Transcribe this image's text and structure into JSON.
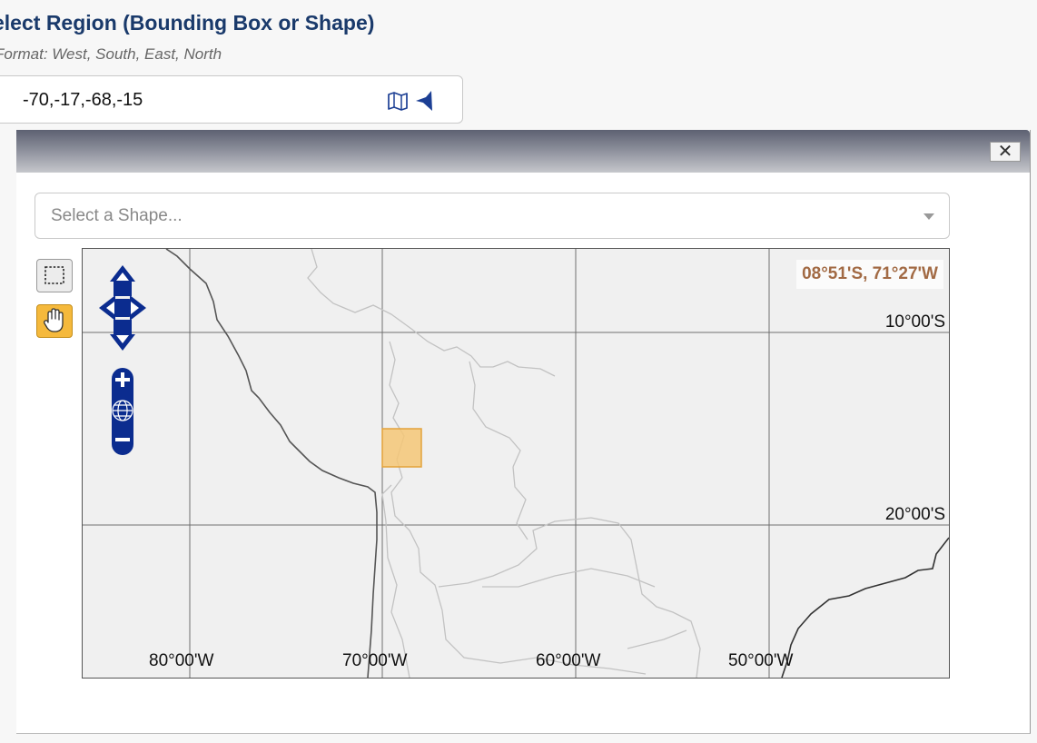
{
  "header": {
    "title": "elect Region (Bounding Box or Shape)",
    "format_hint": "Format: West, South, East, North"
  },
  "bbox_input": {
    "value": "-70,-17,-68,-15"
  },
  "icons": {
    "map_icon": "map-icon",
    "shape_icon": "shape-icon",
    "close_icon": "close-icon",
    "box_tool_icon": "rectangle-select-icon",
    "pan_tool_icon": "hand-pan-icon"
  },
  "dialog": {
    "close_label": "✕",
    "shape_select": {
      "placeholder": "Select a Shape..."
    }
  },
  "map": {
    "coordinate_readout": "08°51'S, 71°27'W",
    "lat_labels": [
      "10°00'S",
      "20°00'S"
    ],
    "lon_labels": [
      "80°00'W",
      "70°00'W",
      "60°00'W",
      "50°00'W"
    ],
    "selected_bbox": {
      "west": -70,
      "south": -17,
      "east": -68,
      "north": -15
    },
    "colors": {
      "selection_fill": "#f5c777",
      "selection_stroke": "#e3a23a",
      "control_blue": "#0b2c8f",
      "pan_tool_active": "#f5b93c"
    }
  }
}
